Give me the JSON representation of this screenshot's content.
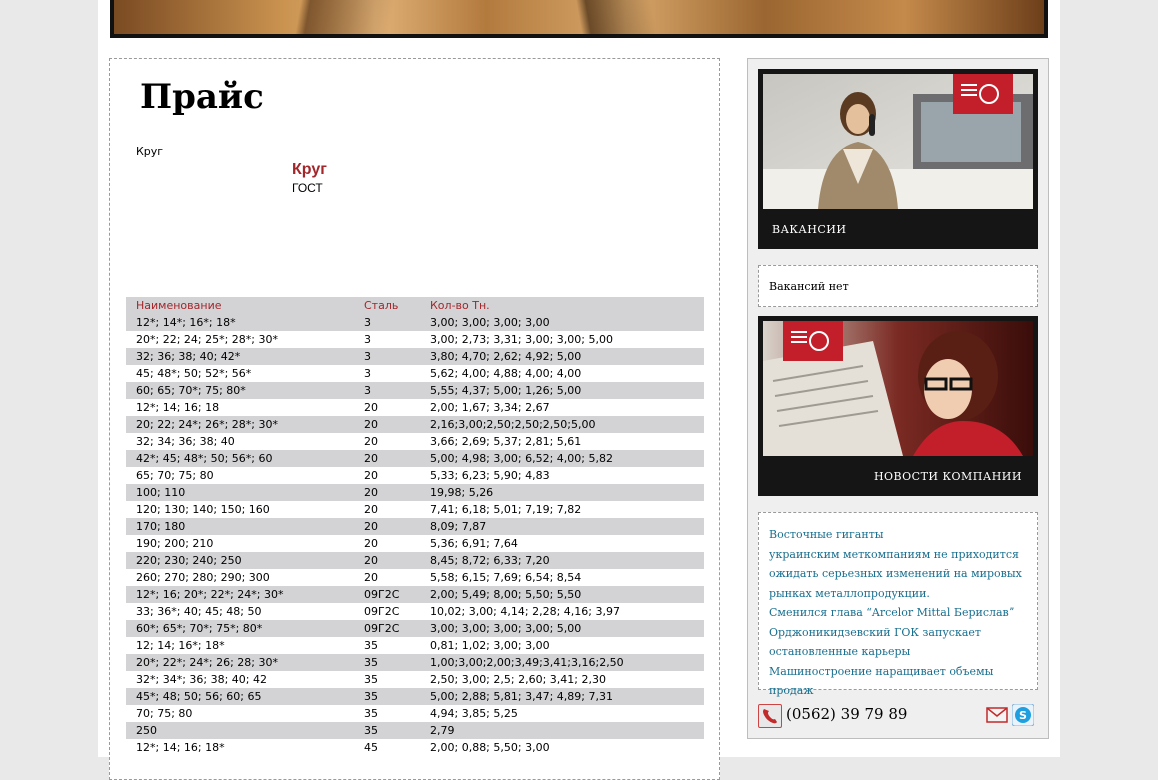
{
  "header": {
    "banner": "decorative-banner"
  },
  "main": {
    "title": "Прайс",
    "breadcrumb_label": "Круг",
    "product_title": "Круг",
    "product_subtitle": "ГОСТ",
    "table": {
      "headers": [
        "Наименование",
        "Сталь",
        "Кол-во Тн."
      ],
      "rows": [
        [
          "12*; 14*; 16*; 18*",
          "3",
          "3,00; 3,00; 3,00; 3,00"
        ],
        [
          "20*; 22; 24; 25*; 28*; 30*",
          "3",
          "3,00; 2,73; 3,31; 3,00; 3,00; 5,00"
        ],
        [
          "32; 36; 38; 40; 42*",
          "3",
          "3,80; 4,70; 2,62; 4,92; 5,00"
        ],
        [
          "45; 48*; 50; 52*; 56*",
          "3",
          "5,62; 4,00; 4,88; 4,00; 4,00"
        ],
        [
          "60; 65; 70*; 75; 80*",
          "3",
          "5,55; 4,37; 5,00; 1,26; 5,00"
        ],
        [
          "12*; 14; 16; 18",
          "20",
          "2,00; 1,67; 3,34; 2,67"
        ],
        [
          "20; 22; 24*; 26*; 28*; 30*",
          "20",
          "2,16;3,00;2,50;2,50;2,50;5,00"
        ],
        [
          "32; 34; 36; 38; 40",
          "20",
          "3,66; 2,69; 5,37; 2,81; 5,61"
        ],
        [
          "42*; 45; 48*; 50; 56*; 60",
          "20",
          "5,00; 4,98; 3,00; 6,52; 4,00; 5,82"
        ],
        [
          "65; 70; 75; 80",
          "20",
          "5,33; 6,23; 5,90; 4,83"
        ],
        [
          "100; 110",
          "20",
          "19,98; 5,26"
        ],
        [
          "120; 130; 140; 150; 160",
          "20",
          "7,41; 6,18; 5,01; 7,19; 7,82"
        ],
        [
          "170; 180",
          "20",
          "8,09; 7,87"
        ],
        [
          "190; 200; 210",
          "20",
          "5,36; 6,91; 7,64"
        ],
        [
          "220; 230; 240; 250",
          "20",
          "8,45; 8,72; 6,33; 7,20"
        ],
        [
          "260; 270; 280; 290; 300",
          "20",
          "5,58; 6,15; 7,69; 6,54; 8,54"
        ],
        [
          "12*; 16; 20*; 22*; 24*; 30*",
          "09Г2С",
          "2,00; 5,49; 8,00; 5,50; 5,50"
        ],
        [
          "33; 36*; 40; 45; 48; 50",
          "09Г2С",
          "10,02; 3,00; 4,14; 2,28; 4,16; 3,97"
        ],
        [
          "60*; 65*; 70*; 75*; 80*",
          "09Г2С",
          "3,00; 3,00; 3,00; 3,00; 5,00"
        ],
        [
          "12; 14; 16*; 18*",
          "35",
          "0,81; 1,02; 3,00; 3,00"
        ],
        [
          "20*; 22*; 24*; 26; 28; 30*",
          "35",
          "1,00;3,00;2,00;3,49;3,41;3,16;2,50"
        ],
        [
          "32*; 34*; 36; 38; 40; 42",
          "35",
          "2,50; 3,00; 2,5; 2,60; 3,41; 2,30"
        ],
        [
          "45*; 48; 50; 56; 60; 65",
          "35",
          "5,00; 2,88; 5,81; 3,47; 4,89; 7,31"
        ],
        [
          "70; 75; 80",
          "35",
          "4,94; 3,85; 5,25"
        ],
        [
          "250",
          "35",
          "2,79"
        ],
        [
          "12*; 14; 16; 18*",
          "45",
          "2,00; 0,88; 5,50; 3,00"
        ]
      ]
    }
  },
  "sidebar": {
    "vacancies_caption": "ВАКАНСИИ",
    "vacancies_text": "Вакансий нет",
    "news_caption": "НОВОСТИ КОМПАНИИ",
    "news": [
      "Восточные гиганты",
      "украинским меткомпаниям не приходится ожидать серьезных изменений на мировых рынках металлопродукции.",
      "Сменился глава “Arcelor Mittal Бериславˮ",
      "Орджоникидзевский ГОК запускает остановленные карьеры",
      "Машиностроение наращивает объемы продаж"
    ],
    "phone": "(0562) 39 79 89",
    "colors": {
      "accent": "#a3262b",
      "link": "#1a6f8f",
      "badge": "#c21f2b"
    }
  }
}
